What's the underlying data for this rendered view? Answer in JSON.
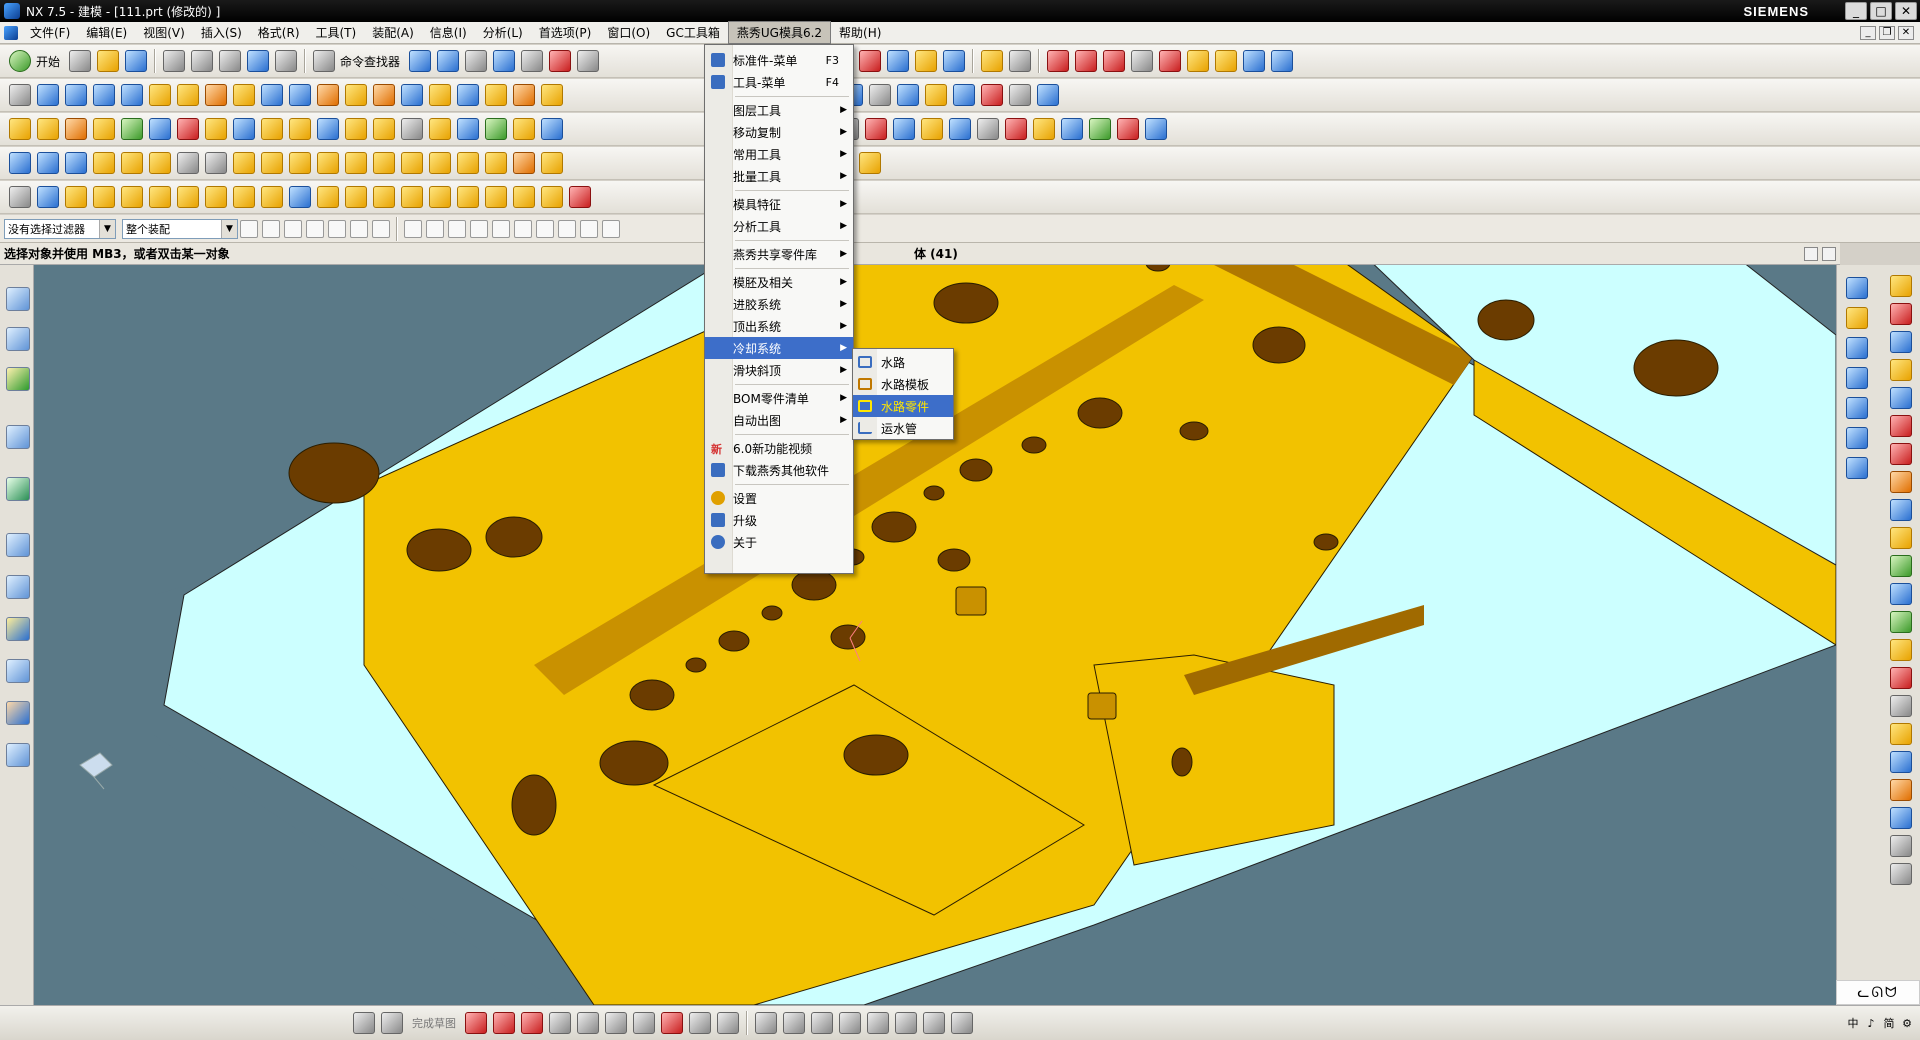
{
  "window": {
    "title": "NX 7.5 - 建模 - [111.prt (修改的) ]",
    "brand": "SIEMENS"
  },
  "menubar": [
    {
      "label": "文件(F)"
    },
    {
      "label": "编辑(E)"
    },
    {
      "label": "视图(V)"
    },
    {
      "label": "插入(S)"
    },
    {
      "label": "格式(R)"
    },
    {
      "label": "工具(T)"
    },
    {
      "label": "装配(A)"
    },
    {
      "label": "信息(I)"
    },
    {
      "label": "分析(L)"
    },
    {
      "label": "首选项(P)"
    },
    {
      "label": "窗口(O)"
    },
    {
      "label": "GC工具箱"
    },
    {
      "label": "燕秀UG模具6.2",
      "active": true
    },
    {
      "label": "帮助(H)"
    }
  ],
  "toolbar": {
    "start_label": "开始",
    "cmd_finder_label": "命令查找器"
  },
  "selection_bar": {
    "filter_value": "没有选择过滤器",
    "assembly_value": "整个装配"
  },
  "cue": {
    "prompt": "选择对象并使用 MB3，或者双击某一对象",
    "status": "体 (41)"
  },
  "dropdown_menu": {
    "items": [
      {
        "label": "标准件-菜单",
        "shortcut": "F3",
        "icon": "grid-icon",
        "color": "#3a6dbf"
      },
      {
        "label": "工具-菜单",
        "shortcut": "F4",
        "icon": "tool-icon",
        "color": "#3a6dbf"
      },
      {
        "label": "图层工具",
        "submenu": true
      },
      {
        "label": "移动复制",
        "submenu": true
      },
      {
        "label": "常用工具",
        "submenu": true
      },
      {
        "label": "批量工具",
        "submenu": true
      },
      {
        "label": "模具特征",
        "submenu": true
      },
      {
        "label": "分析工具",
        "submenu": true
      },
      {
        "label": "燕秀共享零件库",
        "submenu": true
      },
      {
        "label": "模胚及相关",
        "submenu": true
      },
      {
        "label": "进胶系统",
        "submenu": true
      },
      {
        "label": "顶出系统",
        "submenu": true
      },
      {
        "label": "冷却系统",
        "submenu": true,
        "highlighted": true
      },
      {
        "label": "滑块斜顶",
        "submenu": true
      },
      {
        "label": "BOM零件清单",
        "submenu": true
      },
      {
        "label": "自动出图",
        "submenu": true
      },
      {
        "label": "6.0新功能视频",
        "icon": "new-badge-icon",
        "color": "#d43030"
      },
      {
        "label": "下载燕秀其他软件",
        "icon": "download-icon",
        "color": "#3a6dbf"
      },
      {
        "label": "设置",
        "icon": "settings-icon",
        "color": "#e0a000"
      },
      {
        "label": "升级",
        "icon": "upgrade-icon",
        "color": "#3a6dbf"
      },
      {
        "label": "关于",
        "icon": "info-icon",
        "color": "#3a6dbf"
      }
    ]
  },
  "submenu": {
    "items": [
      {
        "label": "水路"
      },
      {
        "label": "水路模板"
      },
      {
        "label": "水路零件",
        "highlighted": true
      },
      {
        "label": "运水管"
      }
    ]
  },
  "bottom_toolbar": {
    "finish_sketch_label": "完成草图"
  },
  "tray": {
    "ime": "ᓚᘏᗢ",
    "tray_labels": [
      "中",
      "♪",
      "简",
      "⚙"
    ]
  },
  "colors": {
    "mold_yellow": "#f2c200",
    "mold_face_light": "#ccffff",
    "mold_side": "#5a7987",
    "menu_highlight": "#3d6ec9"
  }
}
